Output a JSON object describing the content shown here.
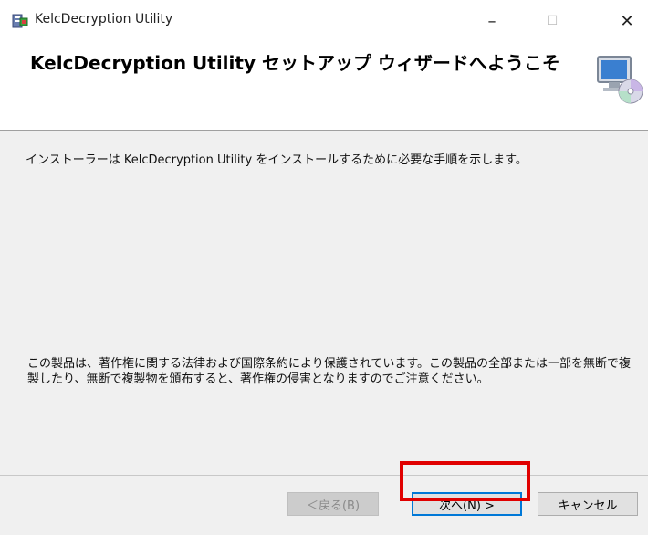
{
  "window": {
    "title": "KelcDecryption Utility",
    "minimize_glyph": "–",
    "maximize_glyph": "☐",
    "close_glyph": "✕"
  },
  "header": {
    "title": "KelcDecryption Utility セットアップ ウィザードへようこそ",
    "icon": "computer-cd-icon"
  },
  "body": {
    "intro": "インストーラーは KelcDecryption Utility をインストールするために必要な手順を示します。",
    "copyright": "この製品は、著作権に関する法律および国際条約により保護されています。この製品の全部または一部を無断で複製したり、無断で複製物を頒布すると、著作権の侵害となりますのでご注意ください。"
  },
  "buttons": {
    "back": "＜戻る(B)",
    "next": "次へ(N) >",
    "cancel": "キャンセル"
  },
  "colors": {
    "highlight": "#e00000",
    "focus": "#0078d7"
  }
}
